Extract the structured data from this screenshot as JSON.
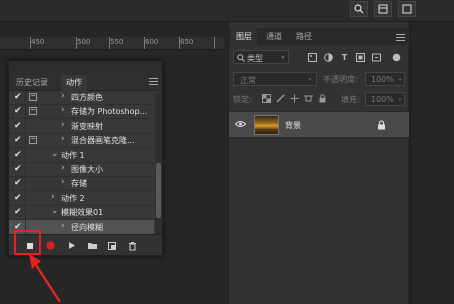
{
  "ruler": {
    "ticks": [
      "450",
      "500",
      "550",
      "600",
      "650"
    ]
  },
  "actions_panel": {
    "tabs": [
      {
        "label": "历史记录",
        "active": false
      },
      {
        "label": "动作",
        "active": true
      }
    ],
    "rows": [
      {
        "label": "四方颜色",
        "checked": true,
        "dialog": true,
        "arrow": "›",
        "selected": false
      },
      {
        "label": "存储为 Photoshop...",
        "checked": true,
        "dialog": true,
        "arrow": "›",
        "selected": false
      },
      {
        "label": "渐变映射",
        "checked": true,
        "dialog": false,
        "arrow": "›",
        "selected": false
      },
      {
        "label": "混合器画笔克隆...",
        "checked": true,
        "dialog": true,
        "arrow": "›",
        "selected": false
      },
      {
        "label": "动作 1",
        "checked": true,
        "dialog": false,
        "arrow": "⌄",
        "selected": false
      },
      {
        "label": "图像大小",
        "checked": true,
        "dialog": false,
        "arrow": "›",
        "selected": false
      },
      {
        "label": "存储",
        "checked": true,
        "dialog": false,
        "arrow": "›",
        "selected": false
      },
      {
        "label": "动作 2",
        "checked": true,
        "dialog": false,
        "arrow": "›",
        "selected": false
      },
      {
        "label": "模糊效果01",
        "checked": true,
        "dialog": false,
        "arrow": "⌄",
        "selected": false
      },
      {
        "label": "径向模糊",
        "checked": true,
        "dialog": false,
        "arrow": "›",
        "selected": true
      }
    ]
  },
  "layers_panel": {
    "tabs": [
      {
        "label": "图层",
        "active": true
      },
      {
        "label": "通道",
        "active": false
      },
      {
        "label": "路径",
        "active": false
      }
    ],
    "filter_label": "类型",
    "blend_mode": "正常",
    "opacity_label": "不透明度:",
    "opacity_value": "100%",
    "lock_label": "锁定:",
    "fill_label": "填充:",
    "fill_value": "100%",
    "layer_name": "背景"
  }
}
